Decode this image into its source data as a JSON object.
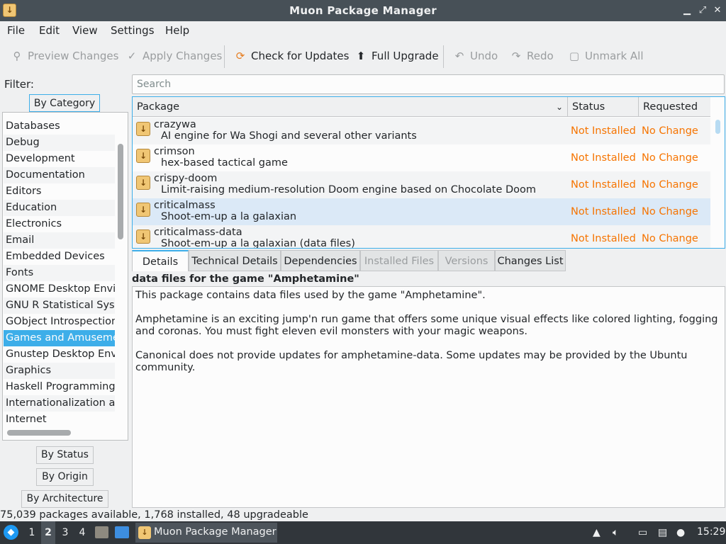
{
  "window": {
    "title": "Muon Package Manager"
  },
  "menu": [
    "File",
    "Edit",
    "View",
    "Settings",
    "Help"
  ],
  "toolbar": {
    "preview_changes": "Preview Changes",
    "apply_changes": "Apply Changes",
    "check_for_updates": "Check for Updates",
    "full_upgrade": "Full Upgrade",
    "undo": "Undo",
    "redo": "Redo",
    "unmark_all": "Unmark All"
  },
  "filter": {
    "label": "Filter:",
    "by_category": "By Category",
    "by_status": "By Status",
    "by_origin": "By Origin",
    "by_architecture": "By Architecture",
    "categories": [
      "Databases",
      "Debug",
      "Development",
      "Documentation",
      "Editors",
      "Education",
      "Electronics",
      "Email",
      "Embedded Devices",
      "Fonts",
      "GNOME Desktop Envir",
      "GNU R Statistical Syste",
      "GObject Introspection",
      "Games and Amusemer",
      "Gnustep Desktop Envir",
      "Graphics",
      "Haskell Programming I",
      "Internationalization an",
      "Internet"
    ],
    "selected_category": "Games and Amusemer"
  },
  "search": {
    "placeholder": "Search"
  },
  "table": {
    "columns": {
      "package": "Package",
      "status": "Status",
      "requested": "Requested"
    },
    "rows": [
      {
        "name": "crazywa",
        "description": "AI engine for Wa Shogi and several other variants",
        "status": "Not Installed",
        "requested": "No Change"
      },
      {
        "name": "crimson",
        "description": "hex-based tactical game",
        "status": "Not Installed",
        "requested": "No Change"
      },
      {
        "name": "crispy-doom",
        "description": "Limit-raising medium-resolution Doom engine based on Chocolate Doom",
        "status": "Not Installed",
        "requested": "No Change"
      },
      {
        "name": "criticalmass",
        "description": "Shoot-em-up a la galaxian",
        "status": "Not Installed",
        "requested": "No Change"
      },
      {
        "name": "criticalmass-data",
        "description": "Shoot-em-up a la galaxian (data files)",
        "status": "Not Installed",
        "requested": "No Change"
      }
    ]
  },
  "details": {
    "tabs": {
      "details": "Details",
      "technical_details": "Technical Details",
      "dependencies": "Dependencies",
      "installed_files": "Installed Files",
      "versions": "Versions",
      "changes_list": "Changes List"
    },
    "title": "data files for the game \"Amphetamine\"",
    "paragraphs": [
      "This package contains data files used by the game \"Amphetamine\".",
      "Amphetamine is an exciting jump'n run game that offers some unique visual effects like colored lighting, fogging and coronas. You must fight eleven evil monsters with your magic weapons.",
      "Canonical does not provide updates for amphetamine-data. Some updates may be provided by the Ubuntu community."
    ]
  },
  "statusbar": {
    "text": "75,039 packages available, 1,768 installed, 48 upgradeable"
  },
  "taskbar": {
    "desktops": [
      "1",
      "2",
      "3",
      "4"
    ],
    "current_desktop": "2",
    "task_label": "Muon Package Manager",
    "clock": "15:29"
  },
  "colors": {
    "accent": "#3daee9",
    "status_text": "#f67400",
    "selection": "#3daee9"
  }
}
